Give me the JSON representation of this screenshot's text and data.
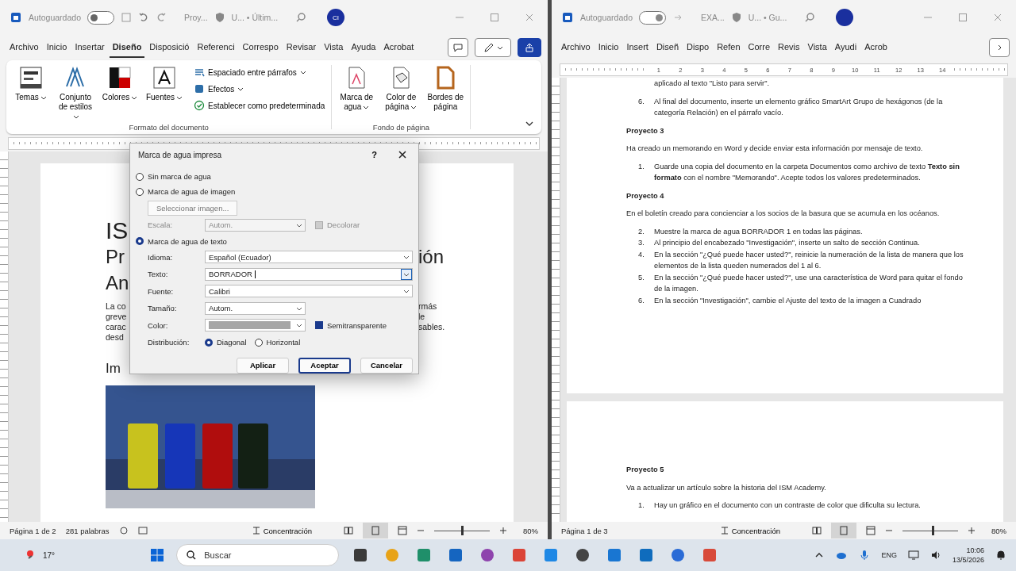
{
  "left_window": {
    "titlebar": {
      "autosave_label": "Autoguardado",
      "autosave_on": false,
      "doc_title": "Proy...",
      "location": "U... • Últim...",
      "avatar": "CI"
    },
    "tabs": [
      {
        "label": "Archivo",
        "selected": false
      },
      {
        "label": "Inicio",
        "selected": false
      },
      {
        "label": "Insertar",
        "selected": false
      },
      {
        "label": "Diseño",
        "selected": true
      },
      {
        "label": "Disposició",
        "selected": false
      },
      {
        "label": "Referenci",
        "selected": false
      },
      {
        "label": "Correspo",
        "selected": false
      },
      {
        "label": "Revisar",
        "selected": false
      },
      {
        "label": "Vista",
        "selected": false
      },
      {
        "label": "Ayuda",
        "selected": false
      },
      {
        "label": "Acrobat",
        "selected": false
      }
    ],
    "ribbon_groups": [
      {
        "label": "Formato del documento",
        "large_buttons": [
          {
            "label": "Temas",
            "dropdown": true
          },
          {
            "label": "Conjunto de estilos",
            "dropdown": true
          },
          {
            "label": "Colores",
            "dropdown": true
          },
          {
            "label": "Fuentes",
            "dropdown": true
          }
        ],
        "small_buttons": [
          {
            "label": "Espaciado entre párrafos",
            "dropdown": true
          },
          {
            "label": "Efectos",
            "dropdown": true
          },
          {
            "label": "Establecer como predeterminada",
            "dropdown": false
          }
        ]
      },
      {
        "label": "Fondo de página",
        "large_buttons": [
          {
            "label": "Marca de agua",
            "dropdown": true
          },
          {
            "label": "Color de página",
            "dropdown": true
          },
          {
            "label": "Bordes de página",
            "dropdown": false
          }
        ]
      }
    ],
    "page": {
      "heading_left": "IS",
      "title_left": "Pr",
      "title_right": "ión",
      "subtitle_left": "An",
      "body_rows": [
        {
          "left": "La co",
          "right": "rmás"
        },
        {
          "left": "greve",
          "right": "le"
        },
        {
          "left": "carac",
          "right": "sables."
        },
        {
          "left": "desd"
        }
      ],
      "section_left": "Im"
    },
    "dialog": {
      "title": "Marca de agua impresa",
      "help": "?",
      "options": [
        {
          "label": "Sin marca de agua",
          "selected": false
        },
        {
          "label": "Marca de agua de imagen",
          "selected": false
        },
        {
          "label": "Marca de agua de texto",
          "selected": true
        }
      ],
      "select_image_button": "Seleccionar imagen...",
      "scale": {
        "label": "Escala:",
        "value": "Autom.",
        "disabled": true
      },
      "washout": {
        "label": "Decolorar",
        "checked": true,
        "disabled": true
      },
      "fields": [
        {
          "label": "Idioma:",
          "value": "Español (Ecuador)",
          "kind": "wide",
          "focused": false
        },
        {
          "label": "Texto:",
          "value": "BORRADOR",
          "kind": "wide",
          "focused": true
        },
        {
          "label": "Fuente:",
          "value": "Calibri",
          "kind": "wide",
          "focused": false
        },
        {
          "label": "Tamaño:",
          "value": "Autom.",
          "kind": "short",
          "focused": false
        }
      ],
      "color": {
        "label": "Color:"
      },
      "semitransparent": {
        "label": "Semitransparente",
        "checked": true
      },
      "layout": {
        "label": "Distribución:",
        "options": [
          {
            "label": "Diagonal",
            "selected": true
          },
          {
            "label": "Horizontal",
            "selected": false
          }
        ]
      },
      "buttons": [
        {
          "label": "Aplicar",
          "default": false
        },
        {
          "label": "Aceptar",
          "default": true
        },
        {
          "label": "Cancelar",
          "default": false
        }
      ]
    },
    "status": {
      "page": "Página 1 de 2",
      "words": "281 palabras",
      "focus": "Concentración",
      "zoom": "80%",
      "zoom_slider": {
        "level": 0.5
      }
    }
  },
  "right_window": {
    "titlebar": {
      "autosave_label": "Autoguardado",
      "autosave_on": true,
      "doc_title": "EXA...",
      "location": "U... • Gu..."
    },
    "tabs": [
      {
        "label": "Archivo",
        "selected": false
      },
      {
        "label": "Inicio",
        "selected": false
      },
      {
        "label": "Insert",
        "selected": false
      },
      {
        "label": "Diseñ",
        "selected": false
      },
      {
        "label": "Dispo",
        "selected": false
      },
      {
        "label": "Refen",
        "selected": false
      },
      {
        "label": "Corre",
        "selected": false
      },
      {
        "label": "Revis",
        "selected": false
      },
      {
        "label": "Vista",
        "selected": false
      },
      {
        "label": "Ayudi",
        "selected": false
      },
      {
        "label": "Acrob",
        "selected": false
      }
    ],
    "ruler_numbers": [
      "1",
      "2",
      "3",
      "4",
      "5",
      "6",
      "7",
      "8",
      "9",
      "10",
      "11",
      "12",
      "13",
      "14"
    ],
    "page_1": [
      {
        "kind": "continuation",
        "text": "aplicado al texto \"Listo para servir\"."
      },
      {
        "kind": "numbered",
        "number": "6.",
        "text": "Al final del documento, inserte un elemento gráfico SmartArt Grupo de hexágonos (de la categoría Relación) en el párrafo vacío."
      },
      {
        "kind": "heading",
        "text": "Proyecto 3"
      },
      {
        "kind": "paragraph",
        "text": "Ha creado un memorando en Word y decide enviar esta información por mensaje de texto."
      },
      {
        "kind": "numbered",
        "number": "1.",
        "text": "Guarde una copia del documento en la carpeta Documentos como archivo de texto **Texto sin formato** con el nombre \"Memorando\". Acepte todos los valores predeterminados."
      },
      {
        "kind": "heading",
        "text": "Proyecto 4"
      },
      {
        "kind": "paragraph",
        "text": "En el boletín creado para concienciar a los socios de la basura que se acumula en los océanos."
      },
      {
        "kind": "numbered",
        "number": "2.",
        "text": "Muestre la marca de agua BORRADOR 1 en todas las páginas."
      },
      {
        "kind": "numbered",
        "number": "3.",
        "text": "Al principio del encabezado \"Investigación\", inserte un salto de sección Continua."
      },
      {
        "kind": "numbered",
        "number": "4.",
        "text": "En la sección \"¿Qué puede hacer usted?\", reinicie la numeración de la lista de manera que los elementos de la lista queden numerados del 1 al 6."
      },
      {
        "kind": "numbered",
        "number": "5.",
        "text": "En la sección \"¿Qué puede hacer usted?\", use una característica de Word para quitar el fondo de la imagen."
      },
      {
        "kind": "numbered",
        "number": "6.",
        "text": "En la sección \"Investigación\", cambie el Ajuste del texto de la imagen a Cuadrado"
      }
    ],
    "page_2": [
      {
        "kind": "heading",
        "text": "Proyecto 5"
      },
      {
        "kind": "paragraph",
        "text": "Va a actualizar un artículo sobre la historia del ISM Academy."
      },
      {
        "kind": "numbered",
        "number": "1.",
        "text": "Hay un gráfico en el documento con un contraste de color que dificulta su lectura."
      }
    ],
    "status": {
      "page": "Página 1 de 3",
      "focus": "Concentración",
      "zoom": "80%",
      "zoom_slider": {
        "level": 0.55
      }
    }
  },
  "taskbar": {
    "weather": "17°",
    "search": {
      "placeholder": "Buscar"
    },
    "language": "ENG",
    "time": "10:06",
    "date": "13/5/2026"
  }
}
